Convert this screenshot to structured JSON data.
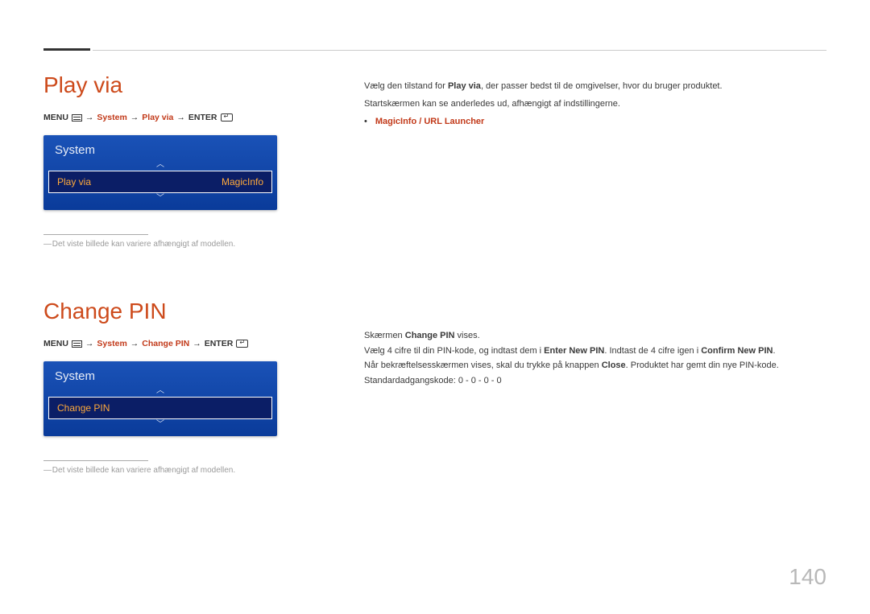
{
  "page_number": "140",
  "section1": {
    "title": "Play via",
    "menu_path": {
      "menu": "MENU",
      "arrow": "→",
      "system": "System",
      "item": "Play via",
      "enter": "ENTER"
    },
    "panel": {
      "header": "System",
      "item_label": "Play via",
      "item_value": "MagicInfo"
    },
    "footnote": "Det viste billede kan variere afhængigt af modellen.",
    "desc": {
      "line1_pre": "Vælg den tilstand for ",
      "line1_bold": "Play via",
      "line1_post": ", der passer bedst til de omgivelser, hvor du bruger produktet.",
      "line2": "Startskærmen kan se anderledes ud, afhængigt af indstillingerne.",
      "bullet": "MagicInfo / URL Launcher"
    }
  },
  "section2": {
    "title": "Change PIN",
    "menu_path": {
      "menu": "MENU",
      "arrow": "→",
      "system": "System",
      "item": "Change PIN",
      "enter": "ENTER"
    },
    "panel": {
      "header": "System",
      "item_label": "Change PIN"
    },
    "footnote": "Det viste billede kan variere afhængigt af modellen.",
    "desc": {
      "l1_pre": "Skærmen ",
      "l1_bold": "Change PIN",
      "l1_post": " vises.",
      "l2_pre": "Vælg 4 cifre til din PIN-kode, og indtast dem i ",
      "l2_bold1": "Enter New PIN",
      "l2_mid": ". Indtast de 4 cifre igen i ",
      "l2_bold2": "Confirm New PIN",
      "l2_post": ".",
      "l3_pre": "Når bekræftelsesskærmen vises, skal du trykke på knappen ",
      "l3_bold": "Close",
      "l3_post": ". Produktet har gemt din nye PIN-kode.",
      "default_pin": "Standardadgangskode: 0 - 0 - 0 - 0"
    }
  }
}
